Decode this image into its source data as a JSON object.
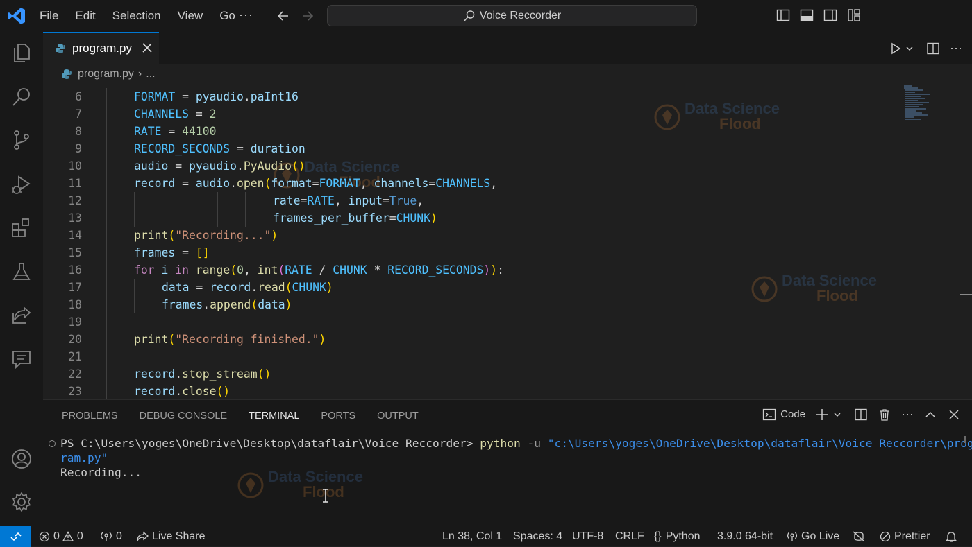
{
  "title_bar": {
    "menu": [
      "File",
      "Edit",
      "Selection",
      "View",
      "Go"
    ],
    "more": "···",
    "search_title": "Voice Reccorder"
  },
  "tab": {
    "label": "program.py",
    "close": "✕"
  },
  "breadcrumb": {
    "file": "program.py",
    "sep": "›",
    "more": "..."
  },
  "editor": {
    "lines": [
      {
        "n": "6",
        "indent": 1,
        "tokens": [
          [
            "FORMAT",
            "c"
          ],
          [
            " = ",
            "p"
          ],
          [
            "pyaudio",
            "v"
          ],
          [
            ".",
            "p"
          ],
          [
            "paInt16",
            "v"
          ]
        ]
      },
      {
        "n": "7",
        "indent": 1,
        "tokens": [
          [
            "CHANNELS",
            "c"
          ],
          [
            " = ",
            "p"
          ],
          [
            "2",
            "n"
          ]
        ]
      },
      {
        "n": "8",
        "indent": 1,
        "tokens": [
          [
            "RATE",
            "c"
          ],
          [
            " = ",
            "p"
          ],
          [
            "44100",
            "n"
          ]
        ]
      },
      {
        "n": "9",
        "indent": 1,
        "tokens": [
          [
            "RECORD_SECONDS",
            "c"
          ],
          [
            " = ",
            "p"
          ],
          [
            "duration",
            "v"
          ]
        ]
      },
      {
        "n": "10",
        "indent": 1,
        "tokens": [
          [
            "audio",
            "v"
          ],
          [
            " = ",
            "p"
          ],
          [
            "pyaudio",
            "v"
          ],
          [
            ".",
            "p"
          ],
          [
            "PyAudio",
            "f"
          ],
          [
            "()",
            "y"
          ]
        ]
      },
      {
        "n": "11",
        "indent": 1,
        "tokens": [
          [
            "record",
            "v"
          ],
          [
            " = ",
            "p"
          ],
          [
            "audio",
            "v"
          ],
          [
            ".",
            "p"
          ],
          [
            "open",
            "f"
          ],
          [
            "(",
            "y"
          ],
          [
            "format",
            "v"
          ],
          [
            "=",
            "p"
          ],
          [
            "FORMAT",
            "c"
          ],
          [
            ", ",
            "p"
          ],
          [
            "channels",
            "v"
          ],
          [
            "=",
            "p"
          ],
          [
            "CHANNELS",
            "c"
          ],
          [
            ",",
            "p"
          ]
        ]
      },
      {
        "n": "12",
        "indent": 6,
        "tokens": [
          [
            "rate",
            "v"
          ],
          [
            "=",
            "p"
          ],
          [
            "RATE",
            "c"
          ],
          [
            ", ",
            "p"
          ],
          [
            "input",
            "v"
          ],
          [
            "=",
            "p"
          ],
          [
            "True",
            "bl"
          ],
          [
            ",",
            "p"
          ]
        ]
      },
      {
        "n": "13",
        "indent": 6,
        "tokens": [
          [
            "frames_per_buffer",
            "v"
          ],
          [
            "=",
            "p"
          ],
          [
            "CHUNK",
            "c"
          ],
          [
            ")",
            "y"
          ]
        ]
      },
      {
        "n": "14",
        "indent": 1,
        "tokens": [
          [
            "print",
            "f"
          ],
          [
            "(",
            "y"
          ],
          [
            "\"Recording...\"",
            "s"
          ],
          [
            ")",
            "y"
          ]
        ]
      },
      {
        "n": "15",
        "indent": 1,
        "tokens": [
          [
            "frames",
            "v"
          ],
          [
            " = ",
            "p"
          ],
          [
            "[]",
            "y"
          ]
        ]
      },
      {
        "n": "16",
        "indent": 1,
        "tokens": [
          [
            "for",
            "k"
          ],
          [
            " ",
            "p"
          ],
          [
            "i",
            "v"
          ],
          [
            " ",
            "p"
          ],
          [
            "in",
            "k"
          ],
          [
            " ",
            "p"
          ],
          [
            "range",
            "f"
          ],
          [
            "(",
            "y"
          ],
          [
            "0",
            "n"
          ],
          [
            ", ",
            "p"
          ],
          [
            "int",
            "f"
          ],
          [
            "(",
            "pk"
          ],
          [
            "RATE",
            "c"
          ],
          [
            " / ",
            "p"
          ],
          [
            "CHUNK",
            "c"
          ],
          [
            " * ",
            "p"
          ],
          [
            "RECORD_SECONDS",
            "c"
          ],
          [
            ")",
            "pk"
          ],
          [
            ")",
            "y"
          ],
          [
            ":",
            "p"
          ]
        ]
      },
      {
        "n": "17",
        "indent": 2,
        "tokens": [
          [
            "data",
            "v"
          ],
          [
            " = ",
            "p"
          ],
          [
            "record",
            "v"
          ],
          [
            ".",
            "p"
          ],
          [
            "read",
            "f"
          ],
          [
            "(",
            "y"
          ],
          [
            "CHUNK",
            "c"
          ],
          [
            ")",
            "y"
          ]
        ]
      },
      {
        "n": "18",
        "indent": 2,
        "tokens": [
          [
            "frames",
            "v"
          ],
          [
            ".",
            "p"
          ],
          [
            "append",
            "f"
          ],
          [
            "(",
            "y"
          ],
          [
            "data",
            "v"
          ],
          [
            ")",
            "y"
          ]
        ]
      },
      {
        "n": "19",
        "indent": 1,
        "tokens": []
      },
      {
        "n": "20",
        "indent": 1,
        "tokens": [
          [
            "print",
            "f"
          ],
          [
            "(",
            "y"
          ],
          [
            "\"Recording finished.\"",
            "s"
          ],
          [
            ")",
            "y"
          ]
        ]
      },
      {
        "n": "21",
        "indent": 1,
        "tokens": []
      },
      {
        "n": "22",
        "indent": 1,
        "tokens": [
          [
            "record",
            "v"
          ],
          [
            ".",
            "p"
          ],
          [
            "stop_stream",
            "f"
          ],
          [
            "()",
            "y"
          ]
        ]
      },
      {
        "n": "23",
        "indent": 1,
        "tokens": [
          [
            "record",
            "v"
          ],
          [
            ".",
            "p"
          ],
          [
            "close",
            "f"
          ],
          [
            "()",
            "y"
          ]
        ]
      }
    ]
  },
  "watermark": {
    "line1": "Data Science",
    "line2": "Flood"
  },
  "panel": {
    "tabs": [
      "PROBLEMS",
      "DEBUG CONSOLE",
      "TERMINAL",
      "PORTS",
      "OUTPUT"
    ],
    "active_tab": "TERMINAL",
    "shell_label": "Code",
    "terminal": {
      "prompt": "PS C:\\Users\\yoges\\OneDrive\\Desktop\\dataflair\\Voice Reccorder> ",
      "command": "python",
      "flag": " -u ",
      "arg_line1": "\"c:\\Users\\yoges\\OneDrive\\Desktop\\dataflair\\Voice Reccorder\\prog",
      "arg_line2": "ram.py\"",
      "output": "Recording..."
    }
  },
  "status_bar": {
    "errors": "0",
    "warnings": "0",
    "ports": "0",
    "live_share": "Live Share",
    "position": "Ln 38, Col 1",
    "spaces": "Spaces: 4",
    "encoding": "UTF-8",
    "eol": "CRLF",
    "language": "Python",
    "interpreter": "3.9.0 64-bit",
    "go_live": "Go Live",
    "prettier": "Prettier"
  },
  "colors": {
    "accent": "#0078d4",
    "editor_bg": "#1f1f1f",
    "chrome_bg": "#181818"
  }
}
